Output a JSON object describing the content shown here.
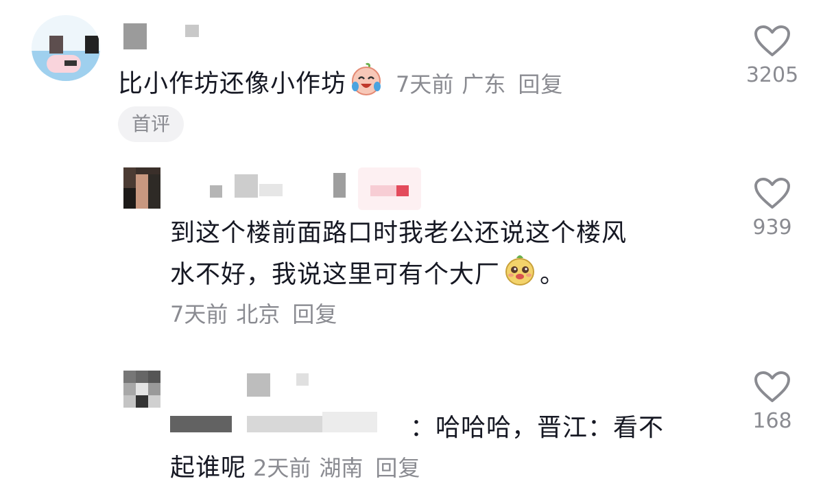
{
  "comments": [
    {
      "text": "比小作坊还像小作坊",
      "time": "7天前",
      "location": "广东",
      "reply_label": "回复",
      "likes": "3205",
      "badge": "首评",
      "emoji": "crying-laughing-face"
    },
    {
      "text_line1": "到这个楼前面路口时我老公还说这个楼风",
      "text_line2_a": "水不好，我说这里可有个大厂",
      "text_line2_b": "。",
      "time": "7天前",
      "location": "北京",
      "reply_label": "回复",
      "likes": "939",
      "emoji": "smiling-mascot-face"
    },
    {
      "text_line1": "：哈哈哈，晋江：看不",
      "text_line2": "起谁呢",
      "time": "2天前",
      "location": "湖南",
      "reply_label": "回复",
      "likes": "168"
    }
  ],
  "colors": {
    "text": "#161823",
    "meta": "#8a8b91",
    "badge_bg": "#f2f2f4",
    "heart_outline": "#8a8b91"
  }
}
